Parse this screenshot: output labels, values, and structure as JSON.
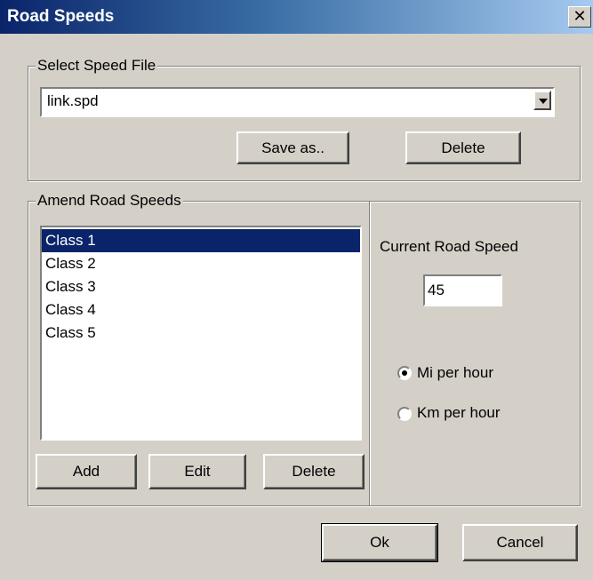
{
  "window": {
    "title": "Road Speeds",
    "close_glyph": "✕"
  },
  "select_speed_file": {
    "legend": "Select Speed File",
    "file_value": "link.spd",
    "save_as_label": "Save as..",
    "delete_label": "Delete"
  },
  "amend_road_speeds": {
    "legend": "Amend Road Speeds",
    "classes": [
      "Class 1",
      "Class 2",
      "Class 3",
      "Class 4",
      "Class 5"
    ],
    "selected_index": 0,
    "add_label": "Add",
    "edit_label": "Edit",
    "delete_label": "Delete",
    "current_speed_label": "Current Road Speed",
    "current_speed_value": "45",
    "units": [
      {
        "label": "Mi per hour",
        "checked": true
      },
      {
        "label": "Km per hour",
        "checked": false
      }
    ]
  },
  "footer": {
    "ok_label": "Ok",
    "cancel_label": "Cancel"
  }
}
